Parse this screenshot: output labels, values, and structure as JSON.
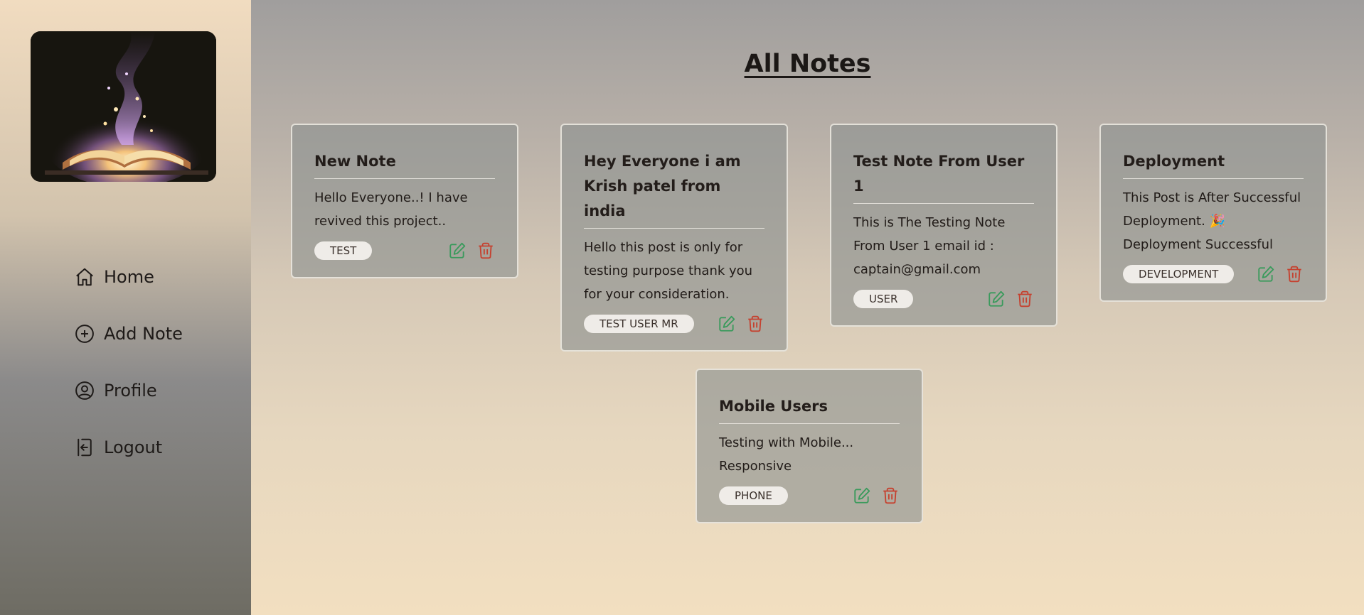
{
  "sidebar": {
    "logo_icon": "magic-book-logo",
    "items": [
      {
        "label": "Home",
        "icon": "home-icon"
      },
      {
        "label": "Add Note",
        "icon": "plus-circle-icon"
      },
      {
        "label": "Profile",
        "icon": "user-circle-icon"
      },
      {
        "label": "Logout",
        "icon": "logout-icon"
      }
    ]
  },
  "main": {
    "title": "All Notes"
  },
  "notes": [
    {
      "title": "New Note",
      "body": "Hello Everyone..! I have revived this project..",
      "tag": "TEST"
    },
    {
      "title": "Hey Everyone i am Krish patel from india",
      "body": "Hello this post is only for testing purpose thank you for your consideration.",
      "tag": "TEST USER MR"
    },
    {
      "title": "Test Note From User 1",
      "body": "This is The Testing Note From User 1 email id : captain@gmail.com",
      "tag": "USER"
    },
    {
      "title": "Deployment",
      "body": "This Post is After Successful Deployment. 🎉 Deployment Successful",
      "tag": "DEVELOPMENT"
    },
    {
      "title": "Mobile Users",
      "body": "Testing with Mobile... Responsive",
      "tag": "PHONE"
    }
  ],
  "colors": {
    "edit_icon": "#3a9a5c",
    "delete_icon": "#c5412f",
    "text": "#1e1a18"
  }
}
